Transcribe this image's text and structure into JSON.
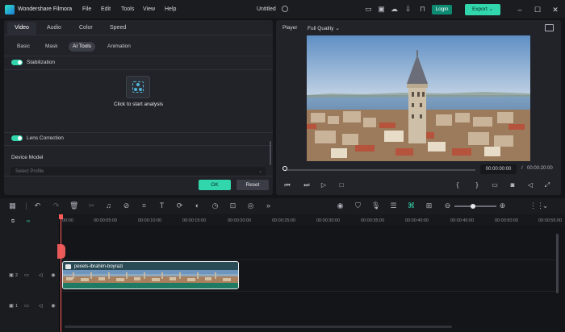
{
  "app": {
    "name": "Wondershare Filmora",
    "document_title": "Untitled",
    "accent": "#32d6ac"
  },
  "menu": [
    "File",
    "Edit",
    "Tools",
    "View",
    "Help"
  ],
  "titlebar": {
    "login_label": "Login",
    "export_label": "Export"
  },
  "left_panel": {
    "tabs": [
      "Video",
      "Audio",
      "Color",
      "Speed"
    ],
    "subtabs": [
      "Basic",
      "Mask",
      "AI Tools",
      "Animation"
    ],
    "stabilization": {
      "label": "Stabilization",
      "enabled": true,
      "hint": "Click to start analysis"
    },
    "lens_correction": {
      "label": "Lens Correction",
      "enabled": true,
      "device_model_label": "Device Model",
      "select_placeholder": "Select Profile"
    },
    "ok_label": "OK",
    "reset_label": "Reset"
  },
  "player": {
    "label": "Player",
    "quality": "Full Quality",
    "current_time": "00:00:00:00",
    "separator": "/",
    "total_time": "00:00:20:00",
    "progress": 0
  },
  "timeline": {
    "ruler_labels": [
      "00:00",
      "00:00:05:00",
      "00:00:10:00",
      "00:00:15:00",
      "00:00:20:00",
      "00:00:25:00",
      "00:00:30:00",
      "00:00:35:00",
      "00:00:40:00",
      "00:00:45:00",
      "00:00:50:00",
      "00:00:55:00"
    ],
    "tracks": [
      {
        "number": "2"
      },
      {
        "number": "1"
      }
    ],
    "clip_name": "pexels-ibrahim-boyrazi"
  }
}
